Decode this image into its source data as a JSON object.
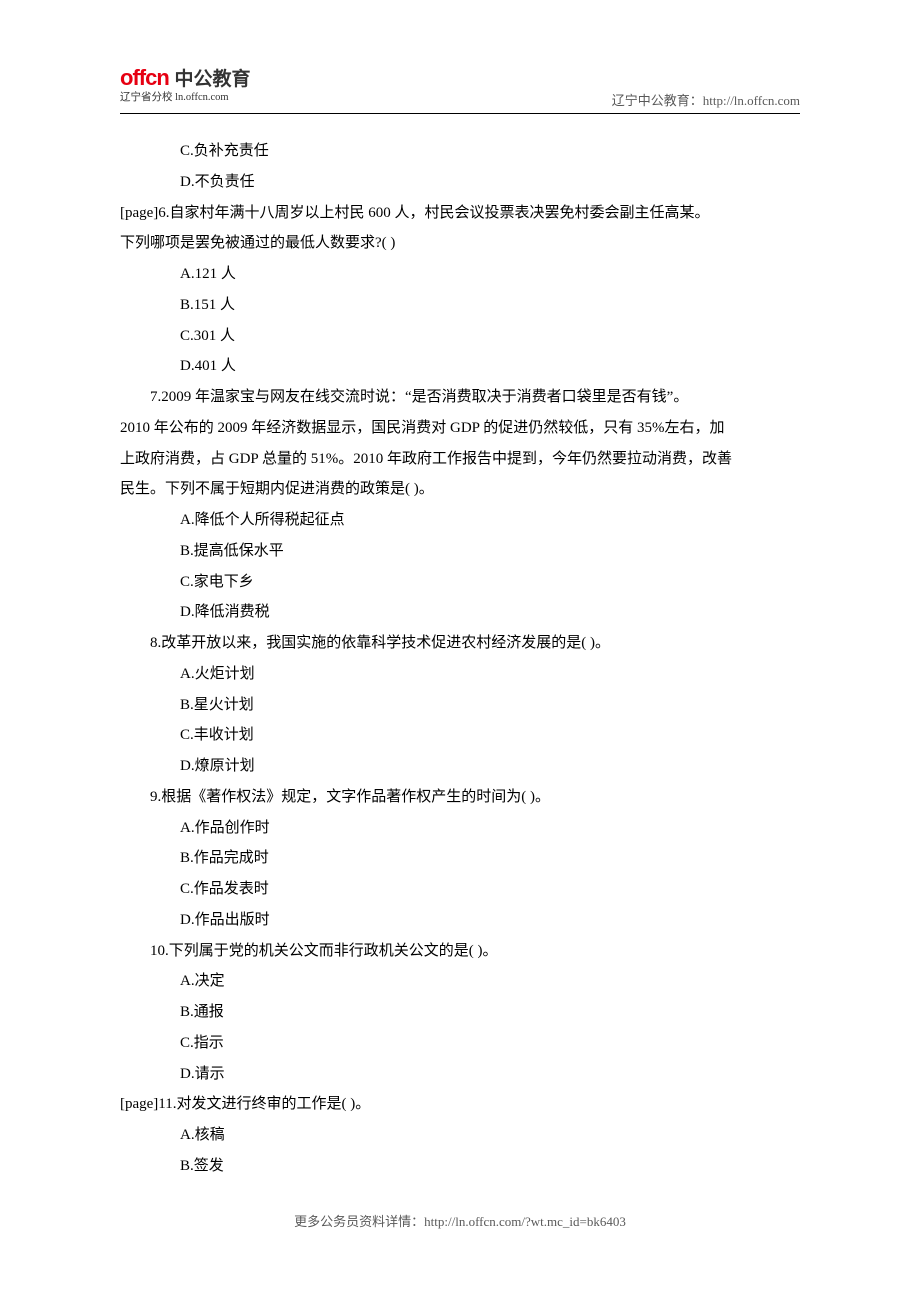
{
  "header": {
    "logo_en": "offcn",
    "logo_cn": "中公教育",
    "logo_sub": "辽宁省分校 ln.offcn.com",
    "right_label": "辽宁中公教育：",
    "right_url": "http://ln.offcn.com"
  },
  "body": {
    "q5_c": "C.负补充责任",
    "q5_d": "D.不负责任",
    "q6_stem_a": "[page]6.自家村年满十八周岁以上村民 600 人，村民会议投票表决罢免村委会副主任高某。",
    "q6_stem_b": "下列哪项是罢免被通过的最低人数要求?( )",
    "q6_a": "A.121 人",
    "q6_b": "B.151 人",
    "q6_c": "C.301 人",
    "q6_d": "D.401 人",
    "q7_stem_a": "7.2009 年温家宝与网友在线交流时说：“是否消费取决于消费者口袋里是否有钱”。",
    "q7_stem_b": "2010 年公布的 2009 年经济数据显示，国民消费对 GDP 的促进仍然较低，只有 35%左右，加",
    "q7_stem_c": "上政府消费，占 GDP 总量的 51%。2010 年政府工作报告中提到，今年仍然要拉动消费，改善",
    "q7_stem_d": "民生。下列不属于短期内促进消费的政策是( )。",
    "q7_a": "A.降低个人所得税起征点",
    "q7_b": "B.提高低保水平",
    "q7_c": "C.家电下乡",
    "q7_d": "D.降低消费税",
    "q8_stem": "8.改革开放以来，我国实施的依靠科学技术促进农村经济发展的是( )。",
    "q8_a": "A.火炬计划",
    "q8_b": "B.星火计划",
    "q8_c": "C.丰收计划",
    "q8_d": "D.燎原计划",
    "q9_stem": "9.根据《著作权法》规定，文字作品著作权产生的时间为( )。",
    "q9_a": "A.作品创作时",
    "q9_b": "B.作品完成时",
    "q9_c": "C.作品发表时",
    "q9_d": "D.作品出版时",
    "q10_stem": "10.下列属于党的机关公文而非行政机关公文的是( )。",
    "q10_a": "A.决定",
    "q10_b": "B.通报",
    "q10_c": "C.指示",
    "q10_d": "D.请示",
    "q11_stem": "[page]11.对发文进行终审的工作是( )。",
    "q11_a": "A.核稿",
    "q11_b": "B.签发"
  },
  "footer": {
    "label": "更多公务员资料详情：",
    "url": "http://ln.offcn.com/?wt.mc_id=bk6403"
  }
}
